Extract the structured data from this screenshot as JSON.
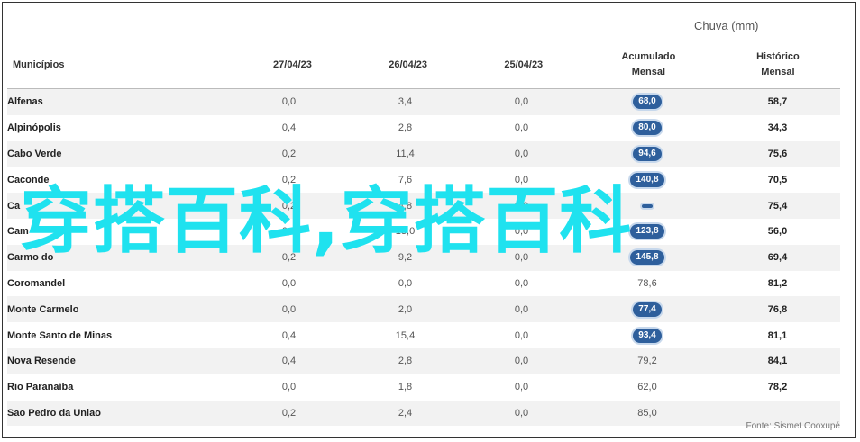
{
  "header": {
    "group": "Chuva (mm)"
  },
  "columns": [
    "Municípios",
    "27/04/23",
    "26/04/23",
    "25/04/23",
    "Acumulado\nMensal",
    "Histórico\nMensal"
  ],
  "rows": [
    {
      "municipio": "Alfenas",
      "d27": "0,0",
      "d26": "3,4",
      "d25": "0,0",
      "acumulado": "68,0",
      "highlight": true,
      "historico": "58,7"
    },
    {
      "municipio": "Alpinópolis",
      "d27": "0,4",
      "d26": "2,8",
      "d25": "0,0",
      "acumulado": "80,0",
      "highlight": true,
      "historico": "34,3"
    },
    {
      "municipio": "Cabo Verde",
      "d27": "0,2",
      "d26": "11,4",
      "d25": "0,0",
      "acumulado": "94,6",
      "highlight": true,
      "historico": "75,6"
    },
    {
      "municipio": "Caconde",
      "d27": "0,2",
      "d26": "7,6",
      "d25": "0,0",
      "acumulado": "140,8",
      "highlight": true,
      "historico": "70,5"
    },
    {
      "municipio": "Ca",
      "d27": "0,2",
      "d26": "4,8",
      "d25": "0,0",
      "acumulado": "",
      "highlight": true,
      "historico": "75,4"
    },
    {
      "municipio": "Cam",
      "d27": "0,0",
      "d26": "13,0",
      "d25": "0,0",
      "acumulado": "123,8",
      "highlight": true,
      "historico": "56,0"
    },
    {
      "municipio": "Carmo do",
      "d27": "0,2",
      "d26": "9,2",
      "d25": "0,0",
      "acumulado": "145,8",
      "highlight": true,
      "historico": "69,4"
    },
    {
      "municipio": "Coromandel",
      "d27": "0,0",
      "d26": "0,0",
      "d25": "0,0",
      "acumulado": "78,6",
      "highlight": false,
      "historico": "81,2"
    },
    {
      "municipio": "Monte Carmelo",
      "d27": "0,0",
      "d26": "2,0",
      "d25": "0,0",
      "acumulado": "77,4",
      "highlight": true,
      "historico": "76,8"
    },
    {
      "municipio": "Monte Santo de Minas",
      "d27": "0,4",
      "d26": "15,4",
      "d25": "0,0",
      "acumulado": "93,4",
      "highlight": true,
      "historico": "81,1"
    },
    {
      "municipio": "Nova Resende",
      "d27": "0,4",
      "d26": "2,8",
      "d25": "0,0",
      "acumulado": "79,2",
      "highlight": false,
      "historico": "84,1"
    },
    {
      "municipio": "Rio Paranaíba",
      "d27": "0,0",
      "d26": "1,8",
      "d25": "0,0",
      "acumulado": "62,0",
      "highlight": false,
      "historico": "78,2"
    },
    {
      "municipio": "Sao Pedro da Uniao",
      "d27": "0,2",
      "d26": "2,4",
      "d25": "0,0",
      "acumulado": "85,0",
      "highlight": false,
      "historico": ""
    }
  ],
  "source": "Fonte: Sismet Cooxupé",
  "watermark": "穿搭百科,穿搭百科",
  "colors": {
    "pill": "#2e5f9c",
    "watermark": "#1fe2ef",
    "stripe": "#f2f2f2"
  },
  "chart_data": {
    "type": "table",
    "title": "",
    "group_header": "Chuva (mm)",
    "columns": [
      "Municípios",
      "27/04/23",
      "26/04/23",
      "25/04/23",
      "Acumulado Mensal",
      "Histórico Mensal"
    ],
    "cells": [
      [
        "Alfenas",
        "0,0",
        "3,4",
        "0,0",
        "68,0",
        "58,7"
      ],
      [
        "Alpinópolis",
        "0,4",
        "2,8",
        "0,0",
        "80,0",
        "34,3"
      ],
      [
        "Cabo Verde",
        "0,2",
        "11,4",
        "0,0",
        "94,6",
        "75,6"
      ],
      [
        "Caconde",
        "0,2",
        "7,6",
        "0,0",
        "140,8",
        "70,5"
      ],
      [
        "Ca",
        "0,2",
        "4,8",
        "0,0",
        "",
        "75,4"
      ],
      [
        "Cam",
        "0,0",
        "13,0",
        "0,0",
        "123,8",
        "56,0"
      ],
      [
        "Carmo do",
        "0,2",
        "9,2",
        "0,0",
        "145,8",
        "69,4"
      ],
      [
        "Coromandel",
        "0,0",
        "0,0",
        "0,0",
        "78,6",
        "81,2"
      ],
      [
        "Monte Carmelo",
        "0,0",
        "2,0",
        "0,0",
        "77,4",
        "76,8"
      ],
      [
        "Monte Santo de Minas",
        "0,4",
        "15,4",
        "0,0",
        "93,4",
        "81,1"
      ],
      [
        "Nova Resende",
        "0,4",
        "2,8",
        "0,0",
        "79,2",
        "84,1"
      ],
      [
        "Rio Paranaíba",
        "0,0",
        "1,8",
        "0,0",
        "62,0",
        "78,2"
      ],
      [
        "Sao Pedro da Uniao",
        "0,2",
        "2,4",
        "0,0",
        "85,0",
        ""
      ]
    ]
  }
}
